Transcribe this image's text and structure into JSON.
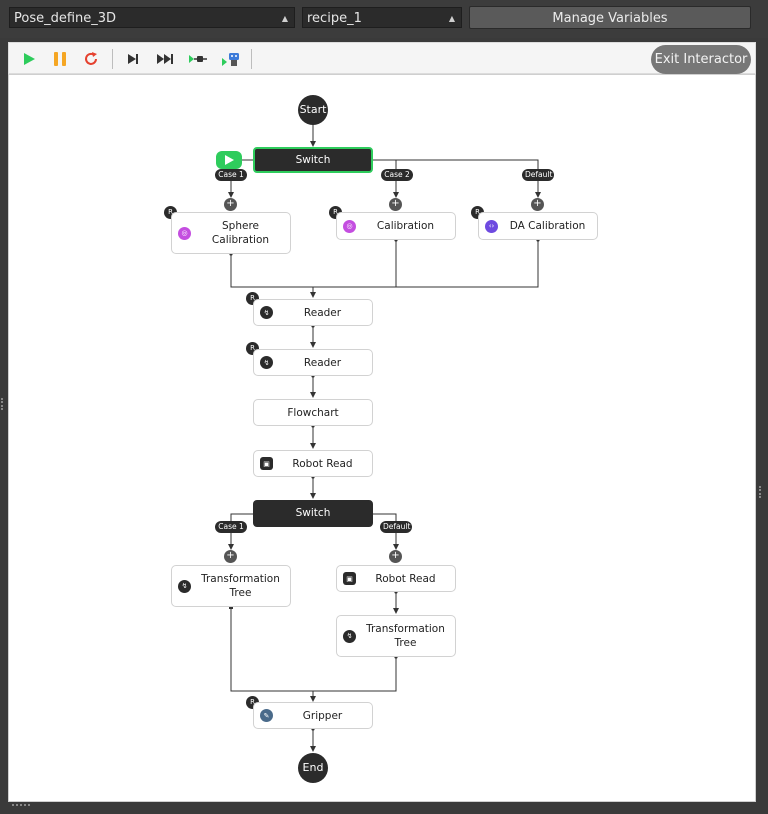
{
  "topbar": {
    "flow_select": "Pose_define_3D",
    "recipe_select": "recipe_1",
    "manage_label": "Manage Variables"
  },
  "toolbar": {
    "exit_label": "Exit Interactor",
    "icons": [
      "play-icon",
      "pause-icon",
      "restart-icon",
      "step-icon",
      "step-over-icon",
      "breakpoint-icon",
      "debug-robot-icon"
    ]
  },
  "flow": {
    "start": "Start",
    "end": "End",
    "switch1": {
      "label": "Switch",
      "cases": [
        "Case 1",
        "Case 2",
        "Default"
      ]
    },
    "case_nodes": [
      "Sphere Calibration",
      "Calibration",
      "DA Calibration"
    ],
    "reader1": "Reader",
    "reader2": "Reader",
    "flowchart": "Flowchart",
    "robot_read": "Robot Read",
    "switch2": {
      "label": "Switch",
      "cases": [
        "Case 1",
        "Default"
      ]
    },
    "transform_left": "Transformation Tree",
    "robot_read_right": "Robot Read",
    "transform_right": "Transformation Tree",
    "gripper": "Gripper",
    "badge": "R",
    "plus": "+"
  },
  "colors": {
    "running": "#2ecc5c",
    "pause": "#f5a623",
    "restart": "#e5412f",
    "node_icon_purple": "#c44ee0",
    "node_icon_violet": "#6e4ae0",
    "node_icon_dark": "#2b2b2b"
  }
}
